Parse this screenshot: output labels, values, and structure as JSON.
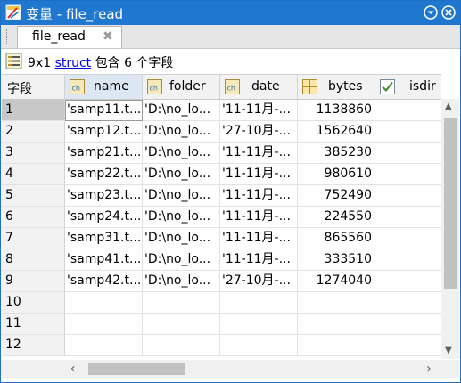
{
  "window": {
    "title": "变量 - file_read",
    "tab_label": "file_read",
    "tab_close": "✖"
  },
  "info": {
    "size": "9x1",
    "type_link": "struct",
    "contains": "包含 6 个字段"
  },
  "table": {
    "corner_label": "字段",
    "columns": [
      "name",
      "folder",
      "date",
      "bytes",
      "isdir"
    ],
    "row_numbers": [
      "1",
      "2",
      "3",
      "4",
      "5",
      "6",
      "7",
      "8",
      "9",
      "10",
      "11",
      "12"
    ],
    "rows": [
      {
        "name": "'samp11.t...",
        "folder": "'D:\\no_lo...",
        "date": "'11-11月-...",
        "bytes": "1138860"
      },
      {
        "name": "'samp12.t...",
        "folder": "'D:\\no_lo...",
        "date": "'27-10月-...",
        "bytes": "1562640"
      },
      {
        "name": "'samp21.t...",
        "folder": "'D:\\no_lo...",
        "date": "'11-11月-...",
        "bytes": "385230"
      },
      {
        "name": "'samp22.t...",
        "folder": "'D:\\no_lo...",
        "date": "'11-11月-...",
        "bytes": "980610"
      },
      {
        "name": "'samp23.t...",
        "folder": "'D:\\no_lo...",
        "date": "'11-11月-...",
        "bytes": "752490"
      },
      {
        "name": "'samp24.t...",
        "folder": "'D:\\no_lo...",
        "date": "'11-11月-...",
        "bytes": "224550"
      },
      {
        "name": "'samp31.t...",
        "folder": "'D:\\no_lo...",
        "date": "'11-11月-...",
        "bytes": "865560"
      },
      {
        "name": "'samp41.t...",
        "folder": "'D:\\no_lo...",
        "date": "'11-11月-...",
        "bytes": "333510"
      },
      {
        "name": "'samp42.t...",
        "folder": "'D:\\no_lo...",
        "date": "'27-10月-...",
        "bytes": "1274040"
      }
    ]
  },
  "icons": {
    "app": "variable-editor-icon",
    "options": "options-menu-icon",
    "close": "close-icon",
    "char_column": "char-array-icon",
    "numeric_column": "numeric-array-icon",
    "logical_column": "logical-checkbox-icon",
    "struct": "struct-icon"
  },
  "colors": {
    "titlebar": "#1f77d0",
    "selected_row_header": "#c8c8c8",
    "link": "#0000ee"
  }
}
